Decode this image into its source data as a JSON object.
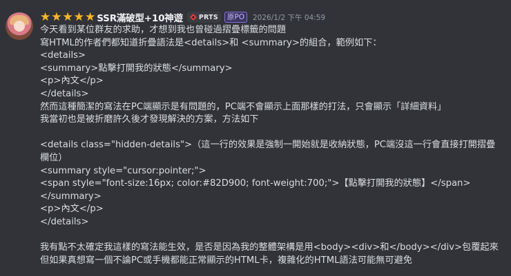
{
  "message": {
    "rating_stars": 5,
    "username": "SSR滿破型+10神遊",
    "clan_tag": "PRTS",
    "role_badge": "原PO",
    "timestamp": "2026/1/2 下午 04:59",
    "lines": [
      "今天看到某位群友的求助，才想到我也曾碰過摺疊標籤的問題",
      "寫HTML的作者們都知道折疊語法是<details>和 <summary>的組合，範例如下：",
      "<details>",
      "<summary>點擊打開我的狀態</summary>",
      "<p>內文</p>",
      "</details>",
      "然而這種簡潔的寫法在PC端顯示是有問題的，PC端不會顯示上面那樣的打法，只會顯示「詳細資料」",
      "我當初也是被折磨許久後才發現解決的方案，方法如下",
      "",
      "<details class=\"hidden-details\">（這一行的效果是強制一開始就是收納狀態，PC端沒這一行會直接打開摺疊欄位）",
      "<summary style=\"cursor:pointer;\">",
      "<span style=\"font-size:16px; color:#82D900; font-weight:700;\">【點擊打開我的狀態】</span>",
      "</summary>",
      "<p>內文</p>",
      "</details>",
      "",
      "我有點不太確定我這樣的寫法能生效，是否是因為我的整體架構是用<body><div>和</body></div>包覆起來",
      "但如果真想寫一個不論PC或手機都能正常顯示的HTML卡，複雜化的HTML語法可能無可避免"
    ]
  },
  "colors": {
    "background": "#313338",
    "text": "#dbdee1",
    "username": "#f2f3f5",
    "star": "#f7b52c",
    "timestamp": "#949ba4",
    "role_badge_border": "#8a6fd9"
  },
  "icons": {
    "star": "star-icon",
    "clan": "clan-badge-icon",
    "avatar": "user-avatar"
  }
}
